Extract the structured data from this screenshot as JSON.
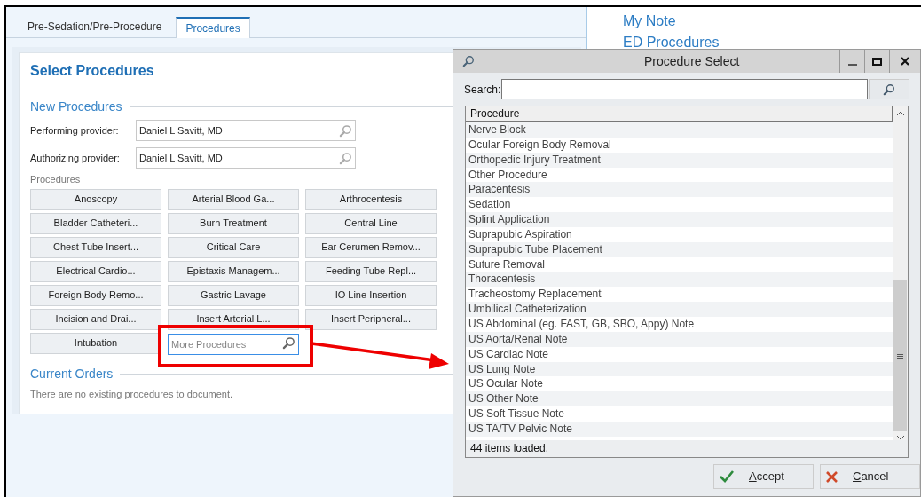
{
  "tabs": [
    {
      "label": "Pre-Sedation/Pre-Procedure",
      "selected": false
    },
    {
      "label": "Procedures",
      "selected": true
    }
  ],
  "card": {
    "title": "Select Procedures",
    "new_section": "New Procedures",
    "providers": [
      {
        "label": "Performing provider:",
        "value": "Daniel L Savitt, MD"
      },
      {
        "label": "Authorizing provider:",
        "value": "Daniel L Savitt, MD"
      }
    ],
    "procedures_label": "Procedures",
    "procedure_buttons": [
      "Anoscopy",
      "Arterial Blood Ga...",
      "Arthrocentesis",
      "Bladder Catheteri...",
      "Burn Treatment",
      "Central Line",
      "Chest Tube Insert...",
      "Critical Care",
      "Ear Cerumen Remov...",
      "Electrical Cardio...",
      "Epistaxis Managem...",
      "Feeding Tube Repl...",
      "Foreign Body Remo...",
      "Gastric Lavage",
      "IO Line Insertion",
      "Incision and Drai...",
      "Insert Arterial L...",
      "Insert Peripheral...",
      "Intubation"
    ],
    "more_search": {
      "placeholder": "More Procedures"
    },
    "current_section": "Current Orders",
    "current_empty": "There are no existing procedures to document."
  },
  "side_links": [
    "My Note",
    "ED Procedures"
  ],
  "dialog": {
    "title": "Procedure Select",
    "search_label": "Search:",
    "column": "Procedure",
    "rows": [
      "Nerve Block",
      "Ocular Foreign Body Removal",
      "Orthopedic Injury Treatment",
      "Other Procedure",
      "Paracentesis",
      "Sedation",
      "Splint Application",
      "Suprapubic Aspiration",
      "Suprapubic Tube Placement",
      "Suture Removal",
      "Thoracentesis",
      "Tracheostomy Replacement",
      "Umbilical Catheterization",
      "US Abdominal (eg. FAST, GB, SBO, Appy) Note",
      "US Aorta/Renal Note",
      "US Cardiac Note",
      "US Lung Note",
      "US Ocular Note",
      "US Other Note",
      "US Soft Tissue Note",
      "US TA/TV Pelvic Note"
    ],
    "status": "44 items loaded.",
    "buttons": [
      {
        "kind": "accept",
        "label": "Accept"
      },
      {
        "kind": "cancel",
        "label": "Cancel"
      }
    ]
  }
}
